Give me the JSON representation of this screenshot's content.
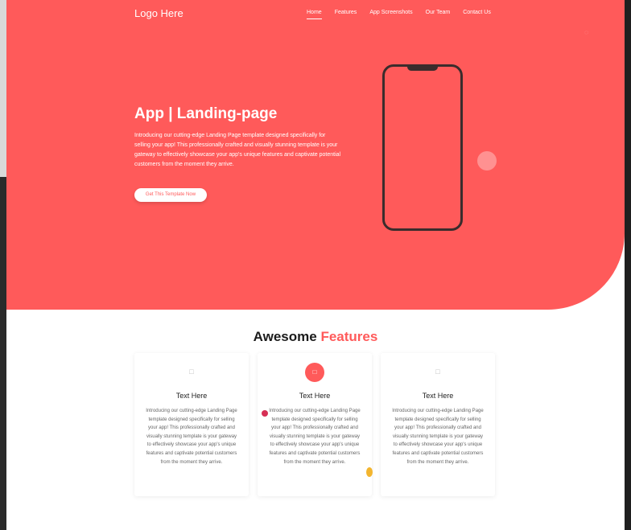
{
  "brand": {
    "logo_text": "Logo Here"
  },
  "nav": {
    "items": [
      "Home",
      "Features",
      "App Screenshots",
      "Our Team",
      "Contact Us"
    ],
    "active": "Home"
  },
  "hero": {
    "title": "App | Landing-page",
    "description": "Introducing our cutting-edge Landing Page template designed specifically for selling your app! This professionally crafted and visually stunning template is your gateway to effectively showcase your app's unique features and captivate potential customers from the moment they arrive.",
    "cta_label": "Get This Template Now"
  },
  "features": {
    "heading_prefix": "Awesome",
    "heading_accent": "Features",
    "cards": [
      {
        "title": "Text Here",
        "text": "Introducing our cutting-edge Landing Page template designed specifically for selling your app! This professionally crafted and visually stunning template is your gateway to effectively showcase your app's unique features and captivate potential customers from the moment they arrive.",
        "icon": "square-icon"
      },
      {
        "title": "Text Here",
        "text": "Introducing our cutting-edge Landing Page template designed specifically for selling your app! This professionally crafted and visually stunning template is your gateway to effectively showcase your app's unique features and captivate potential customers from the moment they arrive.",
        "icon": "square-icon"
      },
      {
        "title": "Text Here",
        "text": "Introducing our cutting-edge Landing Page template designed specifically for selling your app! This professionally crafted and visually stunning template is your gateway to effectively showcase your app's unique features and captivate potential customers from the moment they arrive.",
        "icon": "square-icon"
      }
    ]
  },
  "colors": {
    "accent": "#ff5a5a",
    "white": "#ffffff",
    "dark": "#1b1b1b"
  }
}
